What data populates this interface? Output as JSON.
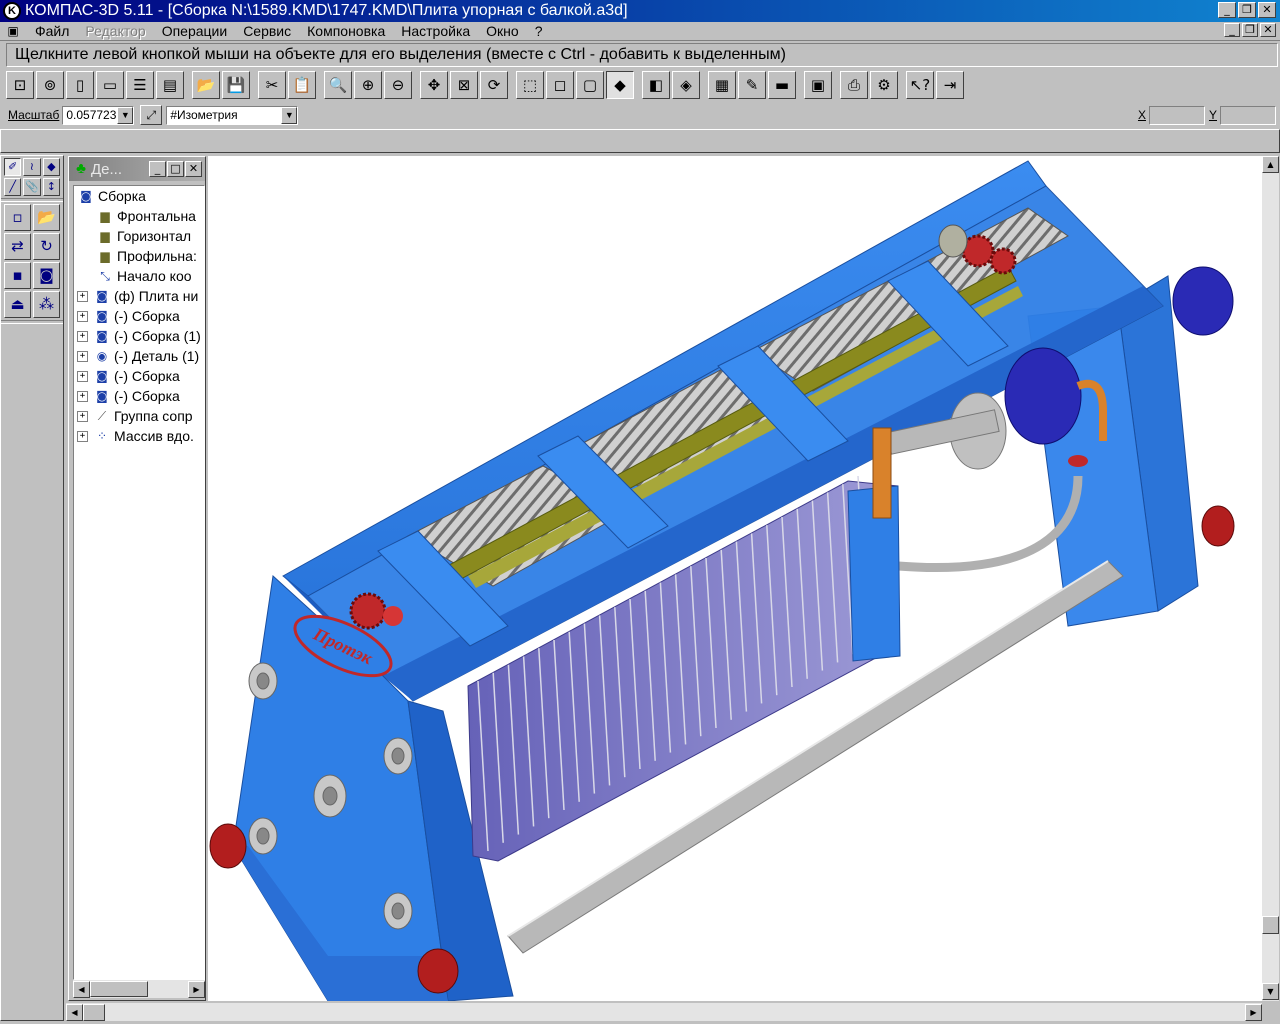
{
  "window": {
    "title": "КОМПАС-3D 5.11 - [Сборка N:\\1589.KMD\\1747.KMD\\Плита упорная с балкой.a3d]",
    "app_icon": "kompas-logo-icon"
  },
  "menu": {
    "items": [
      {
        "label": "Файл",
        "enabled": true
      },
      {
        "label": "Редактор",
        "enabled": false
      },
      {
        "label": "Операции",
        "enabled": true
      },
      {
        "label": "Сервис",
        "enabled": true
      },
      {
        "label": "Компоновка",
        "enabled": true
      },
      {
        "label": "Настройка",
        "enabled": true
      },
      {
        "label": "Окно",
        "enabled": true
      },
      {
        "label": "?",
        "enabled": true
      }
    ]
  },
  "prompt": "Щелкните левой кнопкой мыши на объекте для его выделения (вместе с Ctrl - добавить к выделенным)",
  "propbar": {
    "scale_label": "Масштаб",
    "scale_value": "0.057723",
    "view_value": "#Изометрия",
    "x_label": "X",
    "y_label": "Y",
    "x_value": "",
    "y_value": ""
  },
  "tree": {
    "panel_title": "Де...",
    "nodes": [
      {
        "label": "Сборка",
        "icon": "assembly-icon",
        "expandable": false,
        "indent": 0
      },
      {
        "label": "Фронтальна",
        "icon": "plane-icon",
        "expandable": false,
        "indent": 1
      },
      {
        "label": "Горизонтал",
        "icon": "plane-icon",
        "expandable": false,
        "indent": 1
      },
      {
        "label": "Профильна:",
        "icon": "plane-icon",
        "expandable": false,
        "indent": 1
      },
      {
        "label": "Начало коо",
        "icon": "origin-icon",
        "expandable": false,
        "indent": 1
      },
      {
        "label": "(ф) Плита ни",
        "icon": "assembly-icon",
        "expandable": true,
        "indent": 0
      },
      {
        "label": "(-) Сборка",
        "icon": "assembly-icon",
        "expandable": true,
        "indent": 0
      },
      {
        "label": "(-) Сборка (1)",
        "icon": "assembly-icon",
        "expandable": true,
        "indent": 0
      },
      {
        "label": "(-) Деталь (1)",
        "icon": "part-icon",
        "expandable": true,
        "indent": 0
      },
      {
        "label": "(-) Сборка",
        "icon": "assembly-icon",
        "expandable": true,
        "indent": 0
      },
      {
        "label": "(-) Сборка",
        "icon": "assembly-icon",
        "expandable": true,
        "indent": 0
      },
      {
        "label": "Группа сопр",
        "icon": "mate-group-icon",
        "expandable": true,
        "indent": 0
      },
      {
        "label": "Массив вдо.",
        "icon": "array-icon",
        "expandable": true,
        "indent": 0
      }
    ]
  },
  "logo_text": "Протэк",
  "colors": {
    "frame_blue": "#2f7fe6",
    "frame_dark": "#1d5cc0",
    "plate_purple": "#7b78c4",
    "rail_olive": "#8a8a1e",
    "gear_red": "#c0282a",
    "motor_navy": "#2a2ab5",
    "title_gradient_start": "#000080",
    "title_gradient_end": "#1084d0"
  }
}
